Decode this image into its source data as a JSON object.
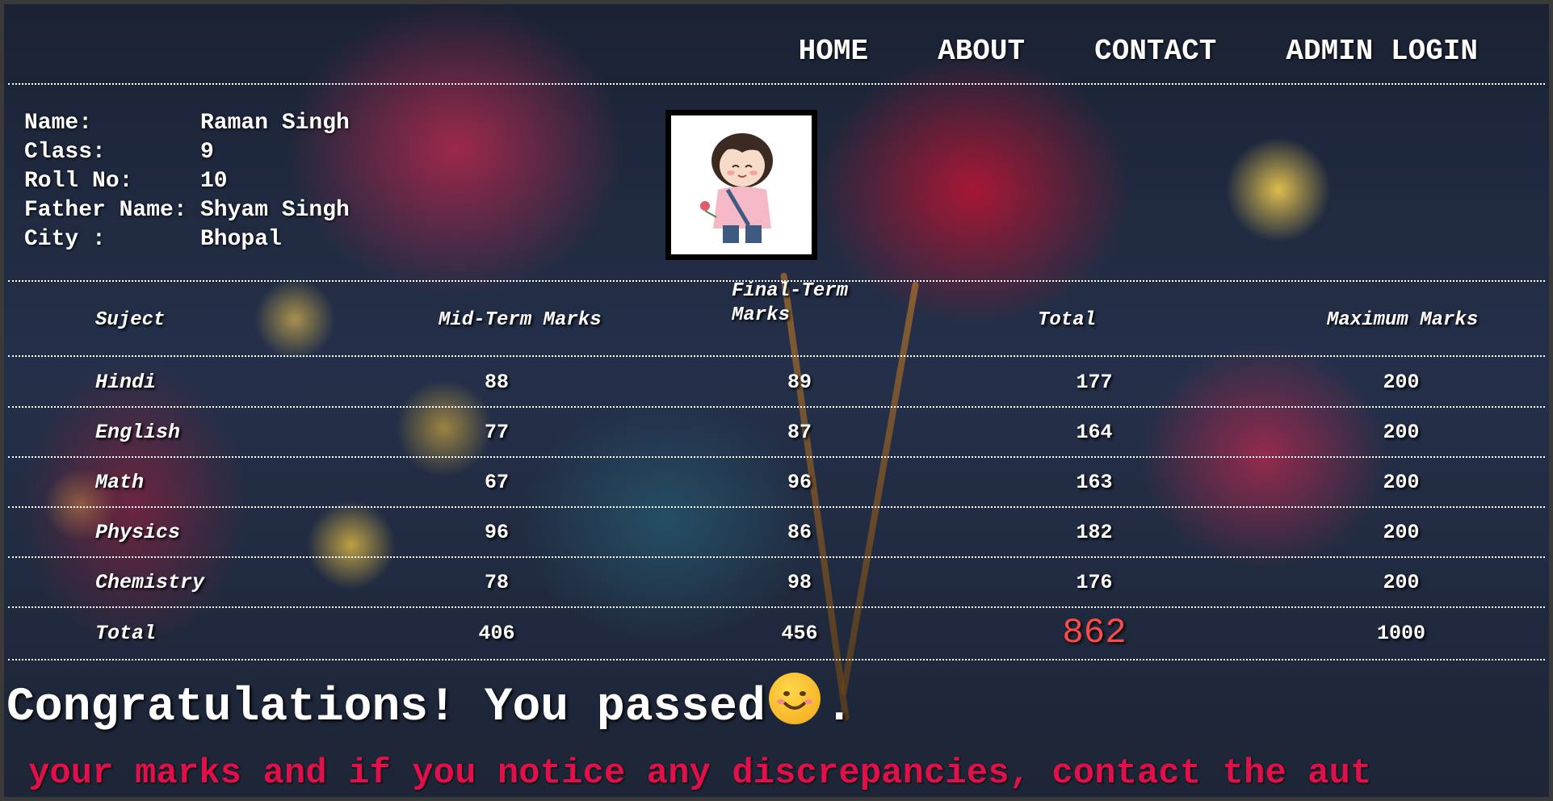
{
  "nav": {
    "items": [
      "HOME",
      "ABOUT",
      "CONTACT",
      "ADMIN LOGIN"
    ]
  },
  "student": {
    "name_label": "Name:",
    "name": "Raman Singh",
    "class_label": "Class:",
    "class": "9",
    "roll_label": "Roll No:",
    "roll": "10",
    "father_label": "Father Name:",
    "father": "Shyam Singh",
    "city_label": "City :",
    "city": "Bhopal"
  },
  "table": {
    "headers": [
      "Suject",
      "Mid-Term Marks",
      "Final-Term Marks",
      "Total",
      "Maximum Marks"
    ],
    "rows": [
      [
        "Hindi",
        "88",
        "89",
        "177",
        "200"
      ],
      [
        "English",
        "77",
        "87",
        "164",
        "200"
      ],
      [
        "Math",
        "67",
        "96",
        "163",
        "200"
      ],
      [
        "Physics",
        "96",
        "86",
        "182",
        "200"
      ],
      [
        "Chemistry",
        "78",
        "98",
        "176",
        "200"
      ]
    ],
    "totals": [
      "Total",
      "406",
      "456",
      "862",
      "1000"
    ]
  },
  "result": {
    "message": "Congratulations! You passed",
    "suffix": ".",
    "emoji": "smiling-face-icon"
  },
  "notice": {
    "text": "your marks and if you notice any discrepancies, contact the aut"
  },
  "colors": {
    "grand_total": "#ff4a4a",
    "notice": "#e0104a"
  }
}
